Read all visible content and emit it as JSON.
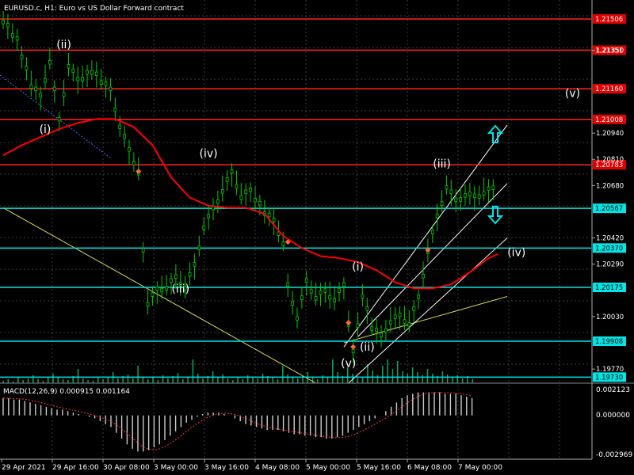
{
  "window": {
    "title": "EURUSD.c, H1:  Euro vs US Dollar Forward contract"
  },
  "macd": {
    "label": "MACD(12,26,9) 0.000915 0.001164",
    "ticks": [
      "0.002123",
      "0.000000",
      "-0.002969"
    ]
  },
  "colors": {
    "background": "#000000",
    "grid": "#3a3a3a",
    "candle": "#00cc00",
    "moving_average": "#ff0000",
    "resistance": "#ff2020",
    "support": "#00e5e5",
    "trendline": "#dddd55",
    "channel": "#ffffff",
    "wave_label": "#ffffff",
    "arrow": "#00e5e5"
  },
  "icons": [
    "arrow-up-icon",
    "arrow-down-icon"
  ],
  "chart_data": {
    "type": "line",
    "symbol": "EURUSD.c",
    "timeframe": "H1",
    "price_ticks": [
      "1.21506",
      "1.21350",
      "1.21160",
      "1.21008",
      "1.20940",
      "1.20810",
      "1.20783",
      "1.20680",
      "1.20567",
      "1.20420",
      "1.20370",
      "1.20290",
      "1.20175",
      "1.20030",
      "1.19908",
      "1.19770",
      "1.19730"
    ],
    "ylim": [
      1.197,
      1.216
    ],
    "time_labels": [
      "29 Apr 2021",
      "29 Apr 16:00",
      "30 Apr 08:00",
      "3 May 00:00",
      "3 May 16:00",
      "4 May 08:00",
      "5 May 00:00",
      "5 May 16:00",
      "6 May 08:00",
      "7 May 00:00"
    ],
    "horizontal_levels": [
      {
        "price": 1.21506,
        "label": "1.21506",
        "kind": "resistance"
      },
      {
        "price": 1.21351,
        "label": "1.21351",
        "kind": "resistance"
      },
      {
        "price": 1.2116,
        "label": "1.21160",
        "kind": "resistance"
      },
      {
        "price": 1.21008,
        "label": "1.21008",
        "kind": "resistance"
      },
      {
        "price": 1.20783,
        "label": "1.20783",
        "kind": "resistance"
      },
      {
        "price": 1.20567,
        "label": "1.20567",
        "kind": "support"
      },
      {
        "price": 1.2037,
        "label": "1.20370",
        "kind": "support"
      },
      {
        "price": 1.20175,
        "label": "1.20175",
        "kind": "support"
      },
      {
        "price": 1.19908,
        "label": "1.19908",
        "kind": "support"
      },
      {
        "price": 1.1973,
        "label": "1.19730",
        "kind": "support"
      }
    ],
    "price_series": [
      {
        "t": 0,
        "p": 1.215
      },
      {
        "t": 3,
        "p": 1.214
      },
      {
        "t": 6,
        "p": 1.2118
      },
      {
        "t": 8,
        "p": 1.2112
      },
      {
        "t": 10,
        "p": 1.213
      },
      {
        "t": 12,
        "p": 1.21
      },
      {
        "t": 14,
        "p": 1.2128
      },
      {
        "t": 16,
        "p": 1.212
      },
      {
        "t": 19,
        "p": 1.2125
      },
      {
        "t": 23,
        "p": 1.2115
      },
      {
        "t": 25,
        "p": 1.2098
      },
      {
        "t": 27,
        "p": 1.2085
      },
      {
        "t": 29,
        "p": 1.2075
      },
      {
        "t": 30,
        "p": 1.2035
      },
      {
        "t": 31,
        "p": 1.201
      },
      {
        "t": 33,
        "p": 1.2016
      },
      {
        "t": 35,
        "p": 1.2018
      },
      {
        "t": 37,
        "p": 1.2022
      },
      {
        "t": 39,
        "p": 1.2018
      },
      {
        "t": 41,
        "p": 1.2028
      },
      {
        "t": 43,
        "p": 1.2048
      },
      {
        "t": 45,
        "p": 1.2056
      },
      {
        "t": 47,
        "p": 1.2066
      },
      {
        "t": 49,
        "p": 1.2074
      },
      {
        "t": 51,
        "p": 1.2063
      },
      {
        "t": 53,
        "p": 1.2065
      },
      {
        "t": 56,
        "p": 1.2055
      },
      {
        "t": 58,
        "p": 1.205
      },
      {
        "t": 60,
        "p": 1.204
      },
      {
        "t": 61,
        "p": 1.2018
      },
      {
        "t": 63,
        "p": 1.2003
      },
      {
        "t": 65,
        "p": 1.202
      },
      {
        "t": 67,
        "p": 1.2013
      },
      {
        "t": 69,
        "p": 1.2015
      },
      {
        "t": 71,
        "p": 1.2012
      },
      {
        "t": 73,
        "p": 1.2018
      },
      {
        "t": 74,
        "p": 1.2
      },
      {
        "t": 75,
        "p": 1.1985
      },
      {
        "t": 77,
        "p": 1.2014
      },
      {
        "t": 78,
        "p": 1.2006
      },
      {
        "t": 79,
        "p": 1.1998
      },
      {
        "t": 81,
        "p": 1.1993
      },
      {
        "t": 83,
        "p": 1.2001
      },
      {
        "t": 85,
        "p": 1.2003
      },
      {
        "t": 87,
        "p": 1.2
      },
      {
        "t": 89,
        "p": 1.2012
      },
      {
        "t": 91,
        "p": 1.2036
      },
      {
        "t": 93,
        "p": 1.2052
      },
      {
        "t": 95,
        "p": 1.2068
      },
      {
        "t": 97,
        "p": 1.206
      },
      {
        "t": 99,
        "p": 1.2064
      },
      {
        "t": 101,
        "p": 1.2062
      },
      {
        "t": 103,
        "p": 1.2065
      },
      {
        "t": 105,
        "p": 1.2066
      },
      {
        "t": 106,
        "p": 1.2058
      }
    ],
    "moving_average": [
      {
        "t": 0,
        "p": 1.2083
      },
      {
        "t": 4,
        "p": 1.2088
      },
      {
        "t": 8,
        "p": 1.2092
      },
      {
        "t": 12,
        "p": 1.2096
      },
      {
        "t": 16,
        "p": 1.2099
      },
      {
        "t": 20,
        "p": 1.2101
      },
      {
        "t": 24,
        "p": 1.2101
      },
      {
        "t": 28,
        "p": 1.2097
      },
      {
        "t": 32,
        "p": 1.2088
      },
      {
        "t": 36,
        "p": 1.2072
      },
      {
        "t": 40,
        "p": 1.2062
      },
      {
        "t": 44,
        "p": 1.2058
      },
      {
        "t": 48,
        "p": 1.2057
      },
      {
        "t": 52,
        "p": 1.2057
      },
      {
        "t": 56,
        "p": 1.2054
      },
      {
        "t": 60,
        "p": 1.2043
      },
      {
        "t": 64,
        "p": 1.2037
      },
      {
        "t": 68,
        "p": 1.2033
      },
      {
        "t": 72,
        "p": 1.2032
      },
      {
        "t": 76,
        "p": 1.203
      },
      {
        "t": 80,
        "p": 1.2026
      },
      {
        "t": 84,
        "p": 1.202
      },
      {
        "t": 88,
        "p": 1.2017
      },
      {
        "t": 92,
        "p": 1.2017
      },
      {
        "t": 96,
        "p": 1.2019
      },
      {
        "t": 100,
        "p": 1.2025
      },
      {
        "t": 104,
        "p": 1.2032
      },
      {
        "t": 106,
        "p": 1.2034
      }
    ],
    "trendlines": [
      {
        "kind": "trendline",
        "from": {
          "t": 0,
          "p": 1.2057
        },
        "to": {
          "t": 67,
          "p": 1.197
        }
      },
      {
        "kind": "trendline",
        "from": {
          "t": 73,
          "p": 1.199
        },
        "to": {
          "t": 108,
          "p": 1.2013
        }
      },
      {
        "kind": "channel",
        "from": {
          "t": 73,
          "p": 1.1988
        },
        "to": {
          "t": 108,
          "p": 1.2098
        }
      },
      {
        "kind": "channel",
        "from": {
          "t": 74,
          "p": 1.197
        },
        "to": {
          "t": 108,
          "p": 1.2042
        }
      },
      {
        "kind": "channel",
        "from": {
          "t": 76,
          "p": 1.1993
        },
        "to": {
          "t": 108,
          "p": 1.2069
        }
      }
    ],
    "wave_labels": [
      {
        "text": "(ii)",
        "t": 13,
        "p": 1.2136
      },
      {
        "text": "(i)",
        "t": 9,
        "p": 1.2094
      },
      {
        "text": "(iv)",
        "t": 44,
        "p": 1.2082
      },
      {
        "text": "(iii)",
        "t": 38,
        "p": 1.2015
      },
      {
        "text": "(v)",
        "t": 74,
        "p": 1.1978
      },
      {
        "text": "(i)",
        "t": 76,
        "p": 1.2026
      },
      {
        "text": "(ii)",
        "t": 78,
        "p": 1.1986
      },
      {
        "text": "(iii)",
        "t": 94,
        "p": 1.2077
      },
      {
        "text": "(iv)",
        "t": 110,
        "p": 1.2033
      },
      {
        "text": "(v)",
        "t": 122,
        "p": 1.2112
      }
    ],
    "macd_histogram": [
      0.0012,
      0.0012,
      0.0011,
      0.0011,
      0.001,
      0.0009,
      0.0008,
      0.0007,
      0.0006,
      0.0005,
      0.0004,
      0.0004,
      0.0003,
      0.0002,
      0.0001,
      0.0,
      -0.0001,
      -0.0002,
      -0.0004,
      -0.0006,
      -0.0008,
      -0.0012,
      -0.0016,
      -0.002,
      -0.0023,
      -0.0025,
      -0.0025,
      -0.0024,
      -0.0022,
      -0.002,
      -0.0017,
      -0.0014,
      -0.0011,
      -0.0008,
      -0.0005,
      -0.0003,
      -0.0001,
      0.0001,
      0.0002,
      0.0002,
      0.0002,
      0.0001,
      0.0,
      -0.0002,
      -0.0004,
      -0.0006,
      -0.0007,
      -0.0008,
      -0.0009,
      -0.001,
      -0.001,
      -0.001,
      -0.0011,
      -0.0012,
      -0.0013,
      -0.0013,
      -0.0014,
      -0.0014,
      -0.0015,
      -0.0015,
      -0.0016,
      -0.0016,
      -0.0015,
      -0.0014,
      -0.0012,
      -0.001,
      -0.0008,
      -0.0006,
      -0.0004,
      -0.0002,
      0.0,
      0.0003,
      0.0006,
      0.0009,
      0.0012,
      0.0014,
      0.0015,
      0.0016,
      0.0016,
      0.0016,
      0.0016,
      0.0016,
      0.0015,
      0.0015,
      0.0015,
      0.0014,
      0.0013,
      0.0012
    ],
    "macd_range": [
      -0.002969,
      0.002123
    ],
    "volume_heights": [
      3,
      5,
      2,
      8,
      4,
      6,
      10,
      5,
      3,
      7,
      12,
      8,
      5,
      4,
      9,
      18,
      6,
      4,
      3,
      7,
      5,
      8,
      14,
      6,
      9,
      11,
      6,
      22,
      8,
      5,
      7,
      4,
      10,
      6,
      9,
      13,
      5,
      8,
      30,
      12,
      6,
      9,
      15,
      7,
      11,
      6,
      4,
      8,
      5,
      10,
      8,
      6,
      12,
      9,
      7,
      5,
      22,
      11,
      8,
      6,
      9,
      14,
      7,
      5,
      10,
      8,
      30,
      14,
      9,
      20,
      12,
      6,
      8,
      24,
      16,
      10,
      22,
      30,
      18,
      28,
      15,
      12,
      20,
      14,
      10,
      18,
      12,
      9,
      15,
      11,
      8,
      10,
      6,
      9,
      5
    ]
  }
}
